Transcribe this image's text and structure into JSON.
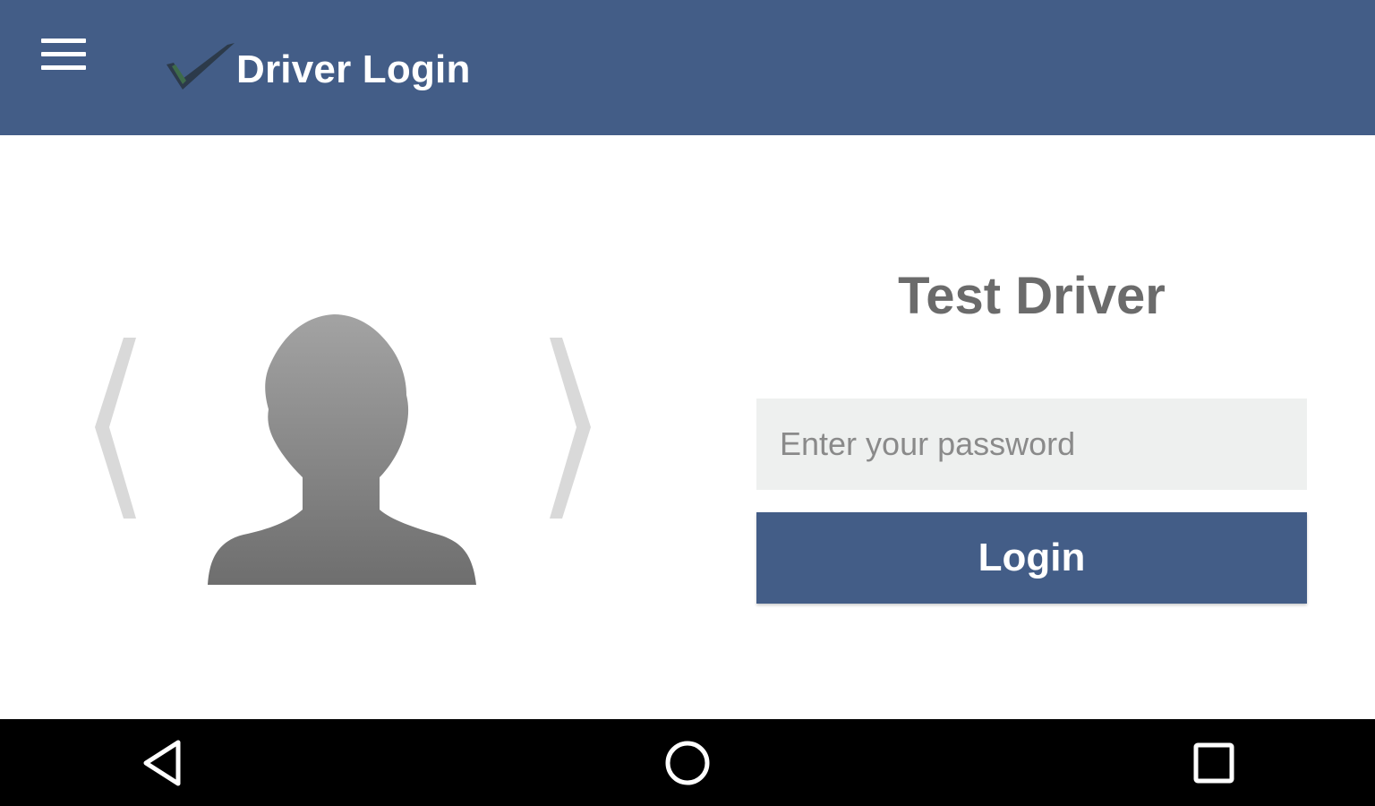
{
  "app_bar": {
    "title": "Driver Login",
    "background_color": "#435d87",
    "menu_icon": "hamburger-menu-icon",
    "logo_icon": "checkmark-logo-icon"
  },
  "driver_selector": {
    "prev_icon": "chevron-left-icon",
    "next_icon": "chevron-right-icon",
    "avatar_icon": "person-silhouette-icon",
    "driver_name": "Test Driver"
  },
  "login_form": {
    "password_placeholder": "Enter your password",
    "password_value": "",
    "login_label": "Login",
    "button_color": "#435d87"
  },
  "system_nav": {
    "back_icon": "back-triangle-icon",
    "home_icon": "home-circle-icon",
    "recents_icon": "recents-square-icon"
  }
}
